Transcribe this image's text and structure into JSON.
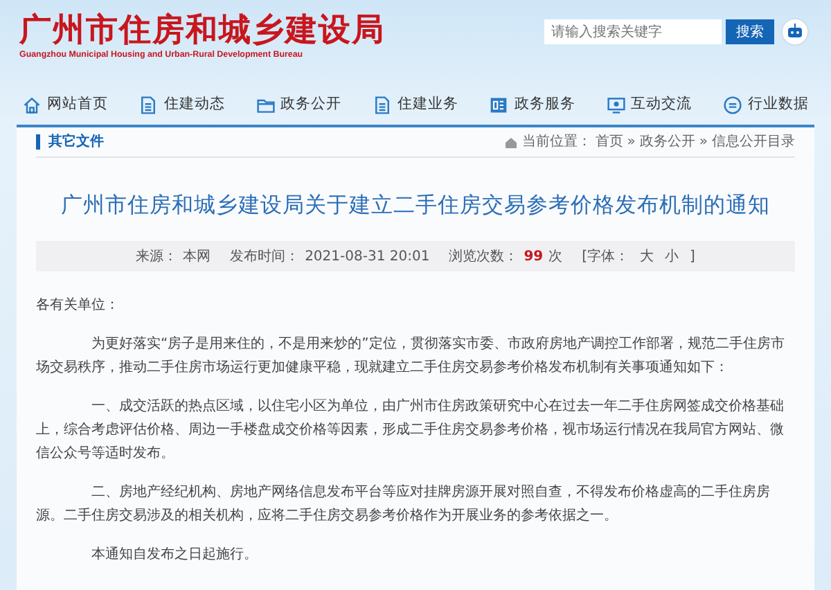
{
  "header": {
    "title": "广州市住房和城乡建设局",
    "subtitle": "Guangzhou Municipal Housing and Urban-Rural Development Bureau",
    "search": {
      "placeholder": "请输入搜索关键字",
      "button": "搜索"
    }
  },
  "nav": [
    {
      "label": "网站首页"
    },
    {
      "label": "住建动态"
    },
    {
      "label": "政务公开"
    },
    {
      "label": "住建业务"
    },
    {
      "label": "政务服务"
    },
    {
      "label": "互动交流"
    },
    {
      "label": "行业数据"
    }
  ],
  "section": {
    "title": "其它文件",
    "breadcrumb": [
      "当前位置：",
      "首页",
      "»",
      "政务公开",
      "»",
      "信息公开目录"
    ]
  },
  "article": {
    "title": "广州市住房和城乡建设局关于建立二手住房交易参考价格发布机制的通知",
    "meta": [
      {
        "label": "来源：",
        "value": "本网"
      },
      {
        "label": "发布时间：",
        "value": "2021-08-31 20:01"
      },
      {
        "label": "浏览次数：",
        "value": "99",
        "unit": "次"
      }
    ],
    "font_size": {
      "label": "[字体：",
      "large": "大",
      "small": "小",
      "close": "]"
    },
    "paragraphs": [
      {
        "text": "各有关单位：",
        "indent": false
      },
      {
        "text": "为更好落实“房子是用来住的，不是用来炒的”定位，贯彻落实市委、市政府房地产调控工作部署，规范二手住房市场交易秩序，推动二手住房市场运行更加健康平稳，现就建立二手住房交易参考价格发布机制有关事项通知如下：",
        "indent": true
      },
      {
        "text": "一、成交活跃的热点区域，以住宅小区为单位，由广州市住房政策研究中心在过去一年二手住房网签成交价格基础上，综合考虑评估价格、周边一手楼盘成交价格等因素，形成二手住房交易参考价格，视市场运行情况在我局官方网站、微信公众号等适时发布。",
        "indent": true
      },
      {
        "text": "二、房地产经纪机构、房地产网络信息发布平台等应对挂牌房源开展对照自查，不得发布价格虚高的二手住房房源。二手住房交易涉及的相关机构，应将二手住房交易参考价格作为开展业务的参考依据之一。",
        "indent": true
      },
      {
        "text": "本通知自发布之日起施行。",
        "indent": true
      }
    ]
  }
}
